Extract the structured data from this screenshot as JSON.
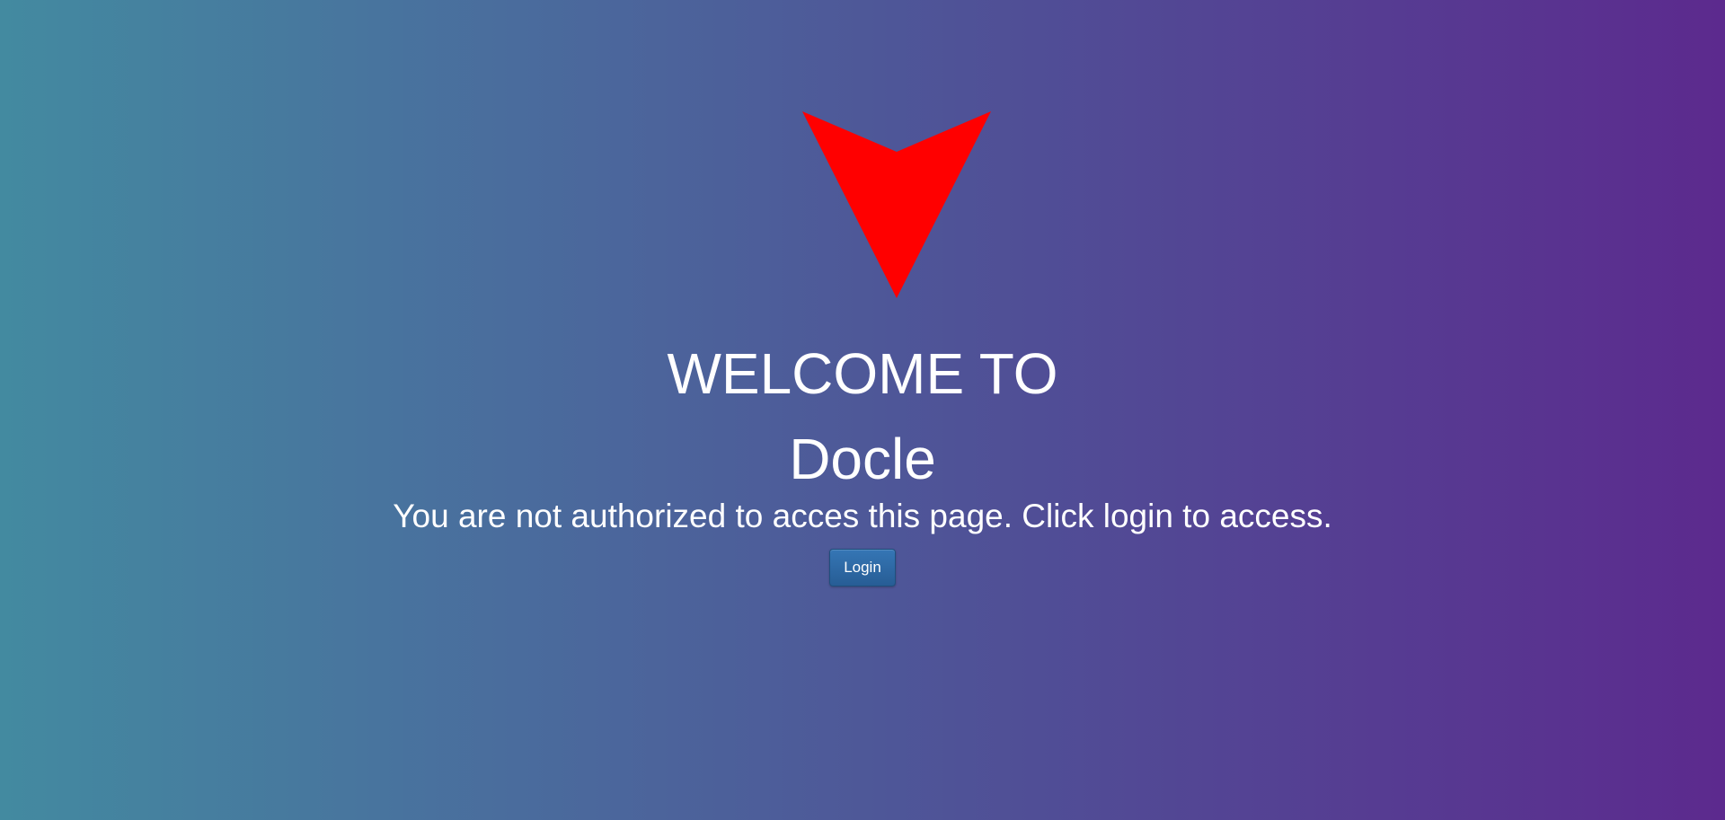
{
  "logo": {
    "icon": "red-arrow-down-icon",
    "color": "#ff0000"
  },
  "header": {
    "welcome": "WELCOME TO",
    "app_name": "Docle"
  },
  "message": "You are not authorized to acces this page. Click login to access.",
  "login_button": {
    "label": "Login",
    "color": "#2e6aa6"
  },
  "background": {
    "gradient_start": "#438aa0",
    "gradient_end": "#5c2a8e"
  }
}
